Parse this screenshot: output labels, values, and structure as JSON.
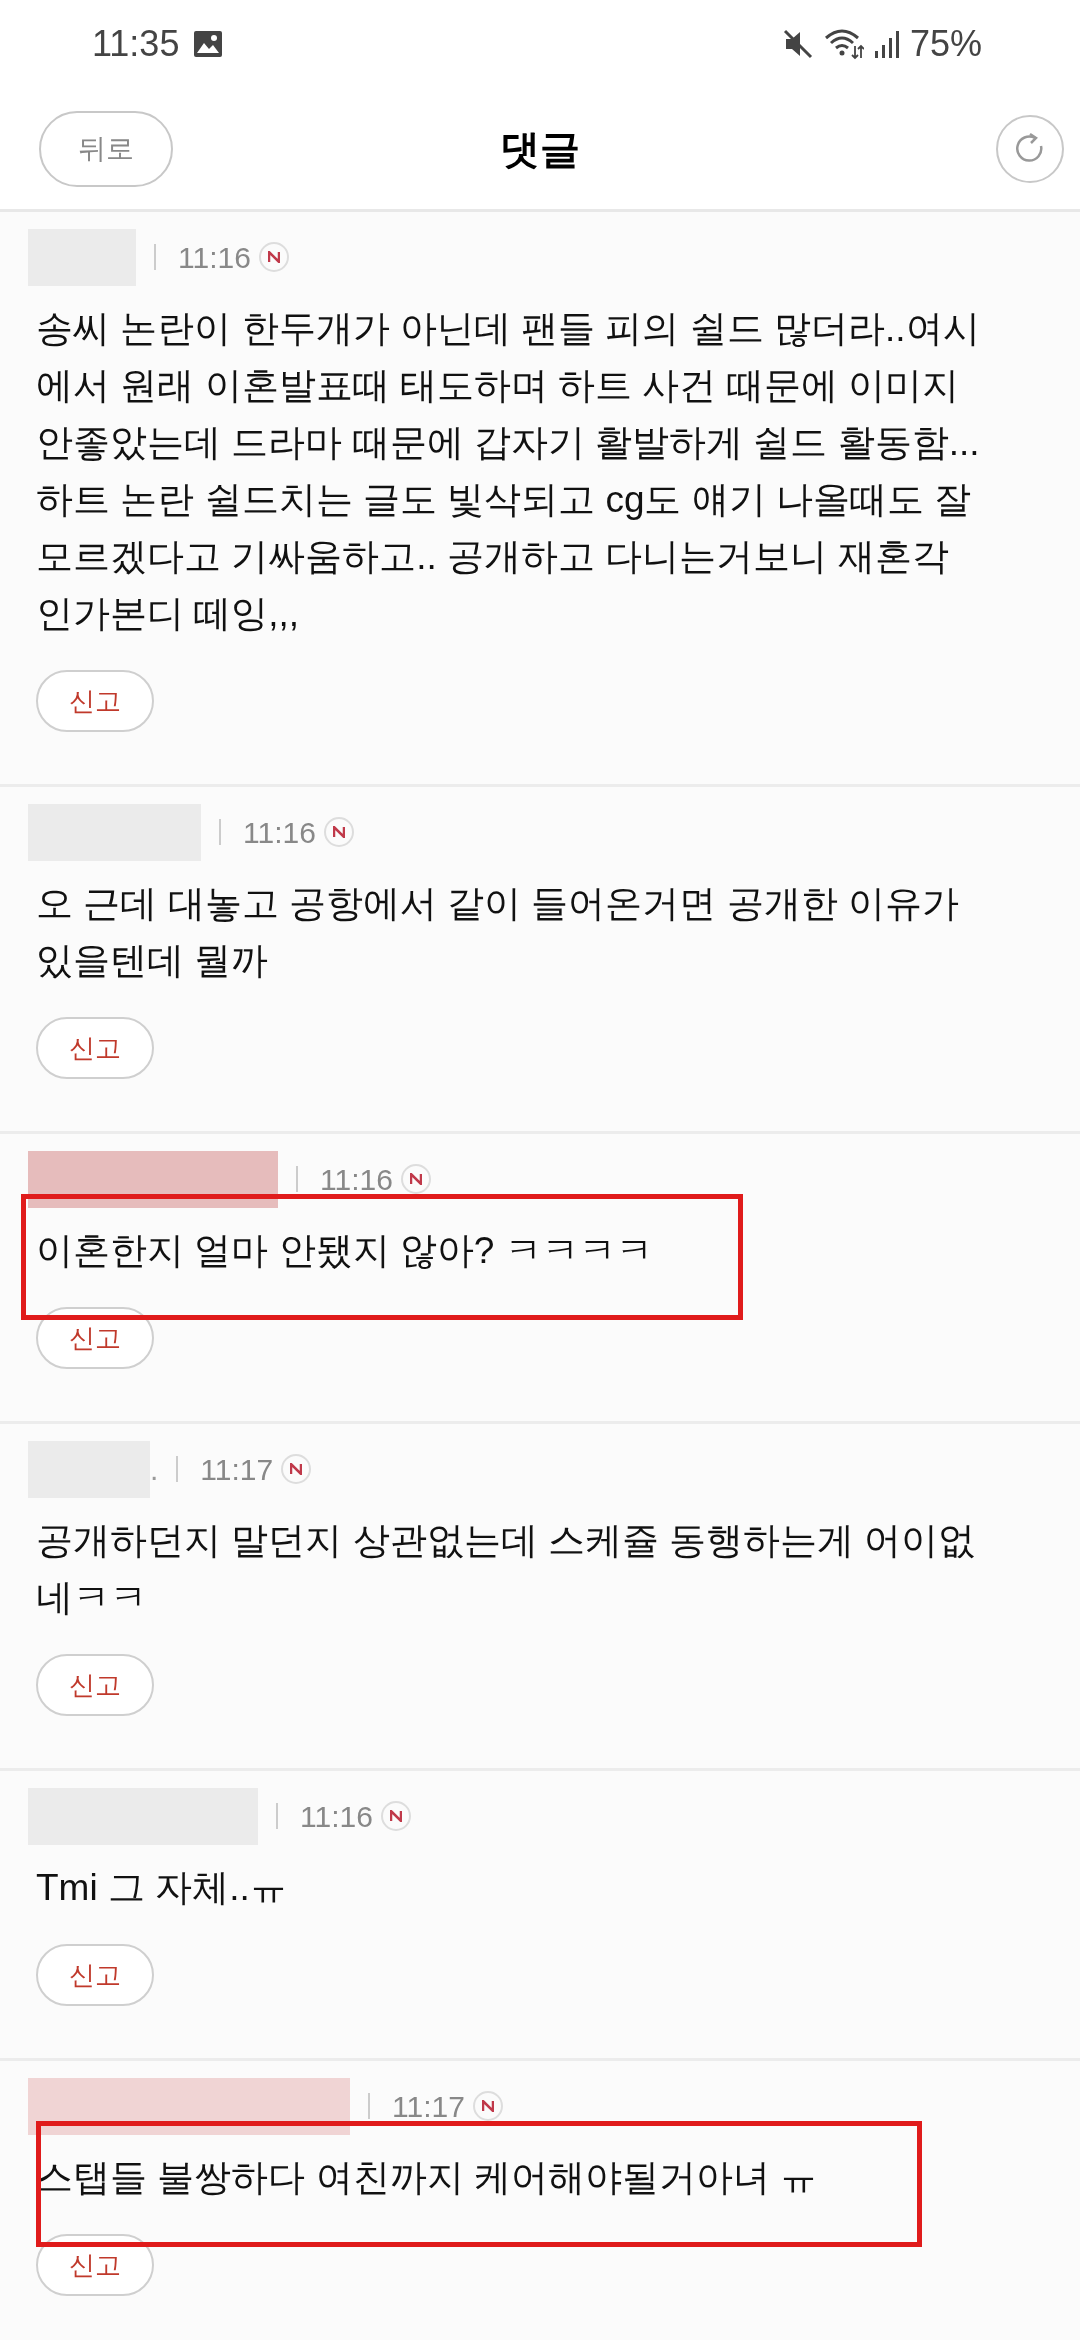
{
  "status_bar": {
    "time": "11:35",
    "battery": "75%"
  },
  "header": {
    "back_button": "뒤로",
    "title": "댓글"
  },
  "comments": [
    {
      "time": "11:16",
      "text": "송씨 논란이 한두개가 아닌데 팬들 피의 쉴드 많더라..여시에서 원래 이혼발표때 태도하며 하트 사건 때문에 이미지 안좋았는데 드라마 때문에 갑자기 활발하게 쉴드 활동함... 하트 논란 쉴드치는 글도 빛삭되고 cg도 얘기 나올때도 잘 모르겠다고 기싸움하고.. 공개하고 다니는거보니 재혼각인가본디 떼잉,,,",
      "report": "신고",
      "highlighted": false,
      "color": "#ebebeb"
    },
    {
      "time": "11:16",
      "text": "오 근데 대놓고 공항에서 같이 들어온거면 공개한 이유가 있을텐데 뭘까",
      "report": "신고",
      "highlighted": false,
      "color": "#ebebeb"
    },
    {
      "time": "11:16",
      "text": "이혼한지 얼마 안됐지 않아? ㅋㅋㅋㅋ",
      "report": "신고",
      "highlighted": true,
      "color": "#e6bcbc"
    },
    {
      "name_suffix": ".",
      "time": "11:17",
      "text": "공개하던지 말던지 상관없는데 스케쥴 동행하는게 어이없네ㅋㅋ",
      "report": "신고",
      "highlighted": false,
      "color": "#ebebeb"
    },
    {
      "time": "11:16",
      "text": "Tmi 그 자체..ㅠ",
      "report": "신고",
      "highlighted": false,
      "color": "#ebebeb"
    },
    {
      "time": "11:17",
      "text": "스탭들 불쌍하다 여친까지 케어해야될거아녀 ㅠ",
      "report": "신고",
      "highlighted": true,
      "color": "#f0d4d4"
    }
  ]
}
